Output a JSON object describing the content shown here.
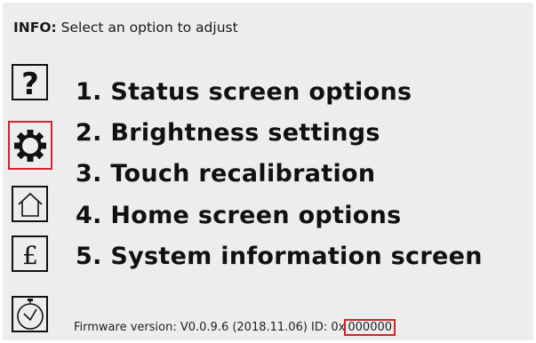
{
  "info": {
    "label": "INFO:",
    "message": "Select an option to adjust"
  },
  "menu": {
    "items": [
      {
        "label": "1. Status screen options",
        "icon": "help-icon"
      },
      {
        "label": "2. Brightness settings",
        "icon": "gear-icon"
      },
      {
        "label": "3. Touch recalibration",
        "icon": null
      },
      {
        "label": "4. Home screen options",
        "icon": "home-icon"
      },
      {
        "label": "5. System information screen",
        "icon": "pound-icon"
      }
    ]
  },
  "footer": {
    "icon": "clock-icon",
    "firmware_prefix": "Firmware version: V0.0.9.6 (2018.11.06) ID: 0x",
    "firmware_id": "000000"
  },
  "colors": {
    "background": "#ededed",
    "text": "#111111",
    "highlight": "#d6222a"
  }
}
